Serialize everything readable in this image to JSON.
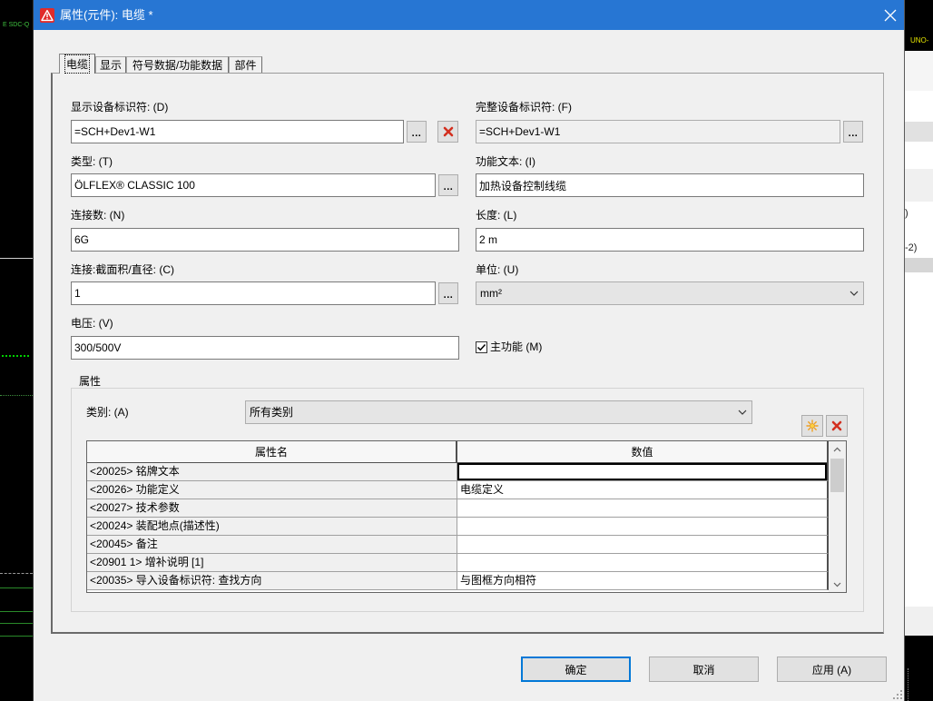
{
  "window": {
    "title": "属性(元件): 电缆 *",
    "title_icon": "warning-icon",
    "close_icon": "close-icon"
  },
  "tabs": [
    {
      "label": "电缆",
      "selected": true
    },
    {
      "label": "显示",
      "selected": false
    },
    {
      "label": "符号数据/功能数据",
      "selected": false
    },
    {
      "label": "部件",
      "selected": false
    }
  ],
  "form": {
    "display_dt": {
      "label": "显示设备标识符: (D)",
      "value": "=SCH+Dev1-W1"
    },
    "full_dt": {
      "label": "完整设备标识符: (F)",
      "value": "=SCH+Dev1-W1"
    },
    "type": {
      "label": "类型: (T)",
      "value": "ÖLFLEX® CLASSIC 100"
    },
    "function_text": {
      "label": "功能文本: (I)",
      "value": "加热设备控制线缆"
    },
    "connections": {
      "label": "连接数: (N)",
      "value": "6G"
    },
    "length": {
      "label": "长度: (L)",
      "value": "2 m"
    },
    "cross_section": {
      "label": "连接:截面积/直径: (C)",
      "value": "1"
    },
    "unit": {
      "label": "单位: (U)",
      "value": "mm²"
    },
    "voltage": {
      "label": "电压: (V)",
      "value": "300/500V"
    },
    "main_function": {
      "label": "主功能 (M)",
      "checked": true
    }
  },
  "properties": {
    "group_label": "属性",
    "category": {
      "label": "类别: (A)",
      "value": "所有类别"
    },
    "columns": [
      "属性名",
      "数值"
    ],
    "rows": [
      {
        "name": "<20025> 铭牌文本",
        "value": ""
      },
      {
        "name": "<20026> 功能定义",
        "value": "电缆定义"
      },
      {
        "name": "<20027> 技术参数",
        "value": ""
      },
      {
        "name": "<20024> 装配地点(描述性)",
        "value": ""
      },
      {
        "name": "<20045> 备注",
        "value": ""
      },
      {
        "name": "<20901 1> 增补说明 [1]",
        "value": ""
      },
      {
        "name": "<20035> 导入设备标识符: 查找方向",
        "value": "与图框方向相符"
      }
    ]
  },
  "buttons": {
    "ellipsis": "...",
    "ok": "确定",
    "cancel": "取消",
    "apply": "应用 (A)"
  },
  "icons": {
    "delete": "delete-x-icon",
    "new": "new-sun-icon",
    "dropdown": "chevron-down-icon",
    "scroll_up": "chevron-up-icon",
    "scroll_down": "chevron-down-icon",
    "check": "checkmark-icon"
  },
  "colors": {
    "title_bar": "#2776d3",
    "focus_border": "#0078d7",
    "delete_red": "#d32f1f",
    "new_icon": "#f0a020",
    "schematic_green": "#3fc03f",
    "schematic_yellow": "#e6e600"
  },
  "background": {
    "left_label": "E SDC-Q",
    "right_label": "UNO-",
    "right_text_1": ")",
    "right_text_2": "-2)"
  }
}
